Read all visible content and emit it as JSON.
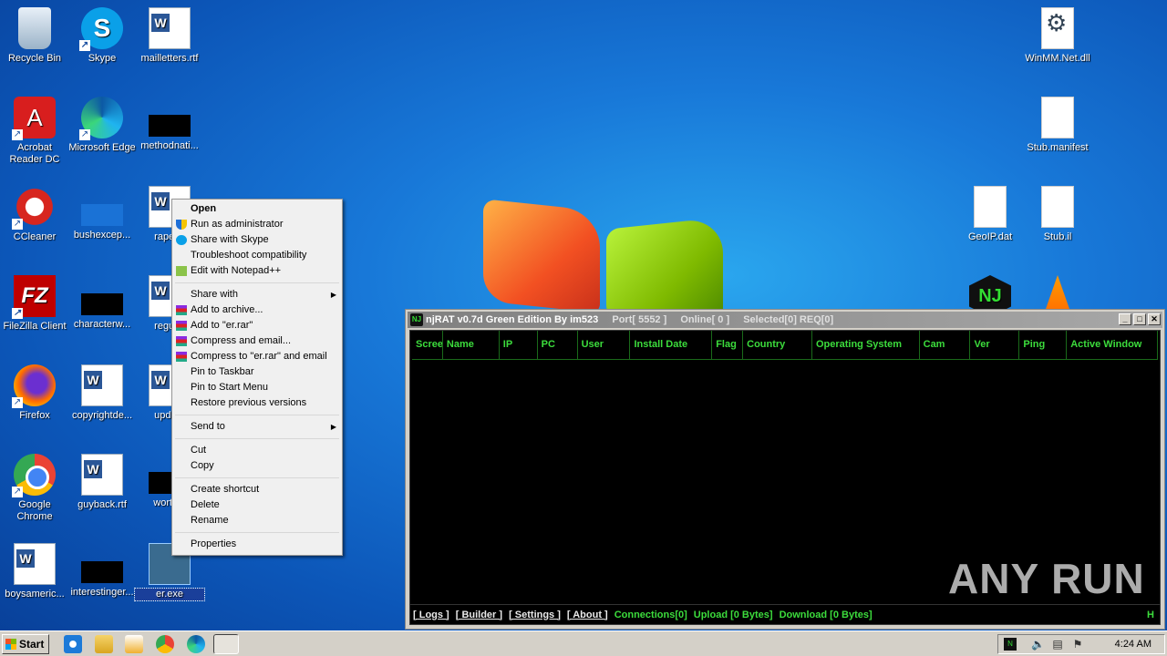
{
  "desktop": {
    "icons_left": [
      {
        "label": "Recycle Bin"
      },
      {
        "label": "Skype"
      },
      {
        "label": "mailletters.rtf"
      },
      {
        "label": "Acrobat Reader DC"
      },
      {
        "label": "Microsoft Edge"
      },
      {
        "label": "methodnati..."
      },
      {
        "label": "CCleaner"
      },
      {
        "label": "bushexcep..."
      },
      {
        "label": "rapeco"
      },
      {
        "label": "FileZilla Client"
      },
      {
        "label": "characterw..."
      },
      {
        "label": "regulat"
      },
      {
        "label": "Firefox"
      },
      {
        "label": "copyrightde..."
      },
      {
        "label": "update"
      },
      {
        "label": "Google Chrome"
      },
      {
        "label": "guyback.rtf"
      },
      {
        "label": "worthin"
      },
      {
        "label": "boysameric..."
      },
      {
        "label": "interestinger..."
      },
      {
        "label": "er.exe"
      }
    ],
    "icons_right": [
      {
        "label": "WinMM.Net.dll"
      },
      {
        "label": "Stub.manifest"
      },
      {
        "label": "GeoIP.dat"
      },
      {
        "label": "Stub.il"
      }
    ]
  },
  "context_menu": {
    "items": [
      {
        "label": "Open"
      },
      {
        "label": "Run as administrator"
      },
      {
        "label": "Share with Skype"
      },
      {
        "label": "Troubleshoot compatibility"
      },
      {
        "label": "Edit with Notepad++"
      },
      {
        "label": "Share with"
      },
      {
        "label": "Add to archive..."
      },
      {
        "label": "Add to \"er.rar\""
      },
      {
        "label": "Compress and email..."
      },
      {
        "label": "Compress to \"er.rar\" and email"
      },
      {
        "label": "Pin to Taskbar"
      },
      {
        "label": "Pin to Start Menu"
      },
      {
        "label": "Restore previous versions"
      },
      {
        "label": "Send to"
      },
      {
        "label": "Cut"
      },
      {
        "label": "Copy"
      },
      {
        "label": "Create shortcut"
      },
      {
        "label": "Delete"
      },
      {
        "label": "Rename"
      },
      {
        "label": "Properties"
      }
    ]
  },
  "njrat": {
    "title": "njRAT v0.7d Green Edition By im523",
    "port": "Port[ 5552 ]",
    "online": "Online[ 0 ]",
    "selected": "Selected[0] REQ[0]",
    "columns": [
      "Scree",
      "Name",
      "IP",
      "PC",
      "User",
      "Install Date",
      "Flag",
      "Country",
      "Operating System",
      "Cam",
      "Ver",
      "Ping",
      "Active Window"
    ],
    "footer": {
      "logs": "[ Logs ]",
      "builder": "[ Builder ]",
      "settings": "[ Settings ]",
      "about": "[ About ]",
      "connections": "Connections[0]",
      "upload": "Upload [0 Bytes]",
      "download": "Download [0 Bytes]",
      "h": "H"
    }
  },
  "watermark": "ANY RUN",
  "taskbar": {
    "start": "Start",
    "clock": "4:24 AM"
  },
  "colors": {
    "rat_green": "#3cdc3c",
    "desktop_blue": "#1878d8"
  }
}
